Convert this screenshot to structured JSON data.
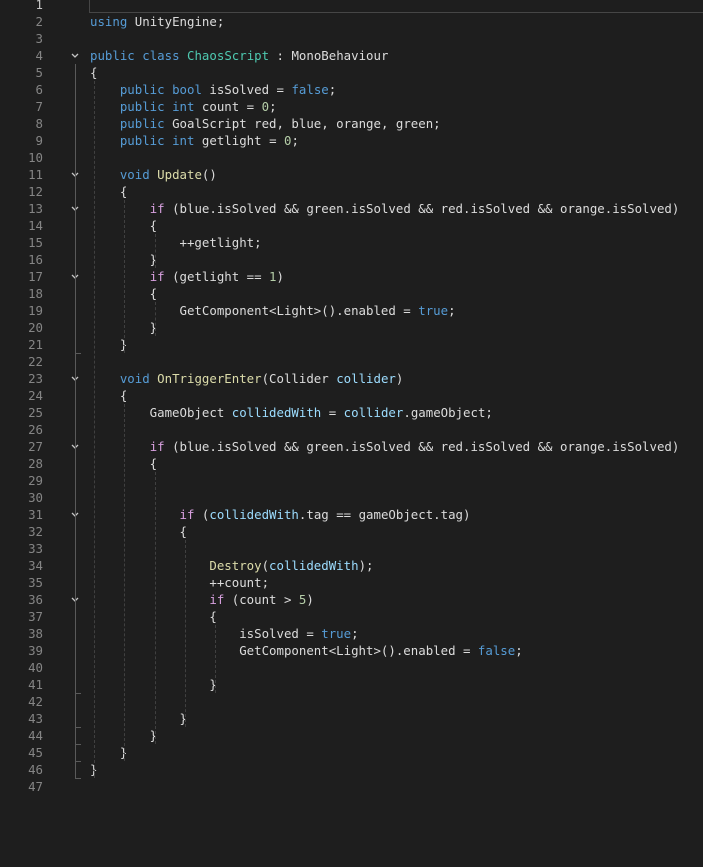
{
  "editor": {
    "language": "csharp",
    "active_line": 1,
    "colors": {
      "background": "#1e1e1e",
      "line_number": "#858585",
      "keyword": "#569cd6",
      "control": "#d8a0df",
      "type": "#4ec9b0",
      "function": "#dcdcaa",
      "number": "#b5cea8",
      "parameter": "#9cdcfe",
      "plain": "#dcdcdc"
    },
    "line_numbers": [
      "1",
      "2",
      "3",
      "4",
      "5",
      "6",
      "7",
      "8",
      "9",
      "10",
      "11",
      "12",
      "13",
      "14",
      "15",
      "16",
      "17",
      "18",
      "19",
      "20",
      "21",
      "22",
      "23",
      "24",
      "25",
      "26",
      "27",
      "28",
      "29",
      "30",
      "31",
      "32",
      "33",
      "34",
      "35",
      "36",
      "37",
      "38",
      "39",
      "40",
      "41",
      "42",
      "43",
      "44",
      "45",
      "46",
      "47"
    ],
    "folding_lines": [
      4,
      11,
      13,
      17,
      23,
      27,
      31,
      36
    ],
    "fold_icon": "chevron-down-icon",
    "lines": [
      [],
      [
        [
          "kw",
          "using"
        ],
        [
          "pl",
          " UnityEngine;"
        ]
      ],
      [],
      [
        [
          "kw",
          "public"
        ],
        [
          "pl",
          " "
        ],
        [
          "kw",
          "class"
        ],
        [
          "pl",
          " "
        ],
        [
          "ty",
          "ChaosScript"
        ],
        [
          "pl",
          " : MonoBehaviour"
        ]
      ],
      [
        [
          "pl",
          "{"
        ]
      ],
      [
        [
          "pl",
          "    "
        ],
        [
          "kw",
          "public"
        ],
        [
          "pl",
          " "
        ],
        [
          "kw",
          "bool"
        ],
        [
          "pl",
          " isSolved = "
        ],
        [
          "kw",
          "false"
        ],
        [
          "pl",
          ";"
        ]
      ],
      [
        [
          "pl",
          "    "
        ],
        [
          "kw",
          "public"
        ],
        [
          "pl",
          " "
        ],
        [
          "kw",
          "int"
        ],
        [
          "pl",
          " count = "
        ],
        [
          "num",
          "0"
        ],
        [
          "pl",
          ";"
        ]
      ],
      [
        [
          "pl",
          "    "
        ],
        [
          "kw",
          "public"
        ],
        [
          "pl",
          " GoalScript red, blue, orange, green;"
        ]
      ],
      [
        [
          "pl",
          "    "
        ],
        [
          "kw",
          "public"
        ],
        [
          "pl",
          " "
        ],
        [
          "kw",
          "int"
        ],
        [
          "pl",
          " getlight = "
        ],
        [
          "num",
          "0"
        ],
        [
          "pl",
          ";"
        ]
      ],
      [],
      [
        [
          "pl",
          "    "
        ],
        [
          "kw",
          "void"
        ],
        [
          "pl",
          " "
        ],
        [
          "fn",
          "Update"
        ],
        [
          "pl",
          "()"
        ]
      ],
      [
        [
          "pl",
          "    {"
        ]
      ],
      [
        [
          "pl",
          "        "
        ],
        [
          "ctl",
          "if"
        ],
        [
          "pl",
          " (blue.isSolved && green.isSolved && red.isSolved && orange.isSolved)"
        ]
      ],
      [
        [
          "pl",
          "        {"
        ]
      ],
      [
        [
          "pl",
          "            ++getlight;"
        ]
      ],
      [
        [
          "pl",
          "        }"
        ]
      ],
      [
        [
          "pl",
          "        "
        ],
        [
          "ctl",
          "if"
        ],
        [
          "pl",
          " (getlight == "
        ],
        [
          "num",
          "1"
        ],
        [
          "pl",
          ")"
        ]
      ],
      [
        [
          "pl",
          "        {"
        ]
      ],
      [
        [
          "pl",
          "            GetComponent<Light>().enabled = "
        ],
        [
          "kw",
          "true"
        ],
        [
          "pl",
          ";"
        ]
      ],
      [
        [
          "pl",
          "        }"
        ]
      ],
      [
        [
          "pl",
          "    }"
        ]
      ],
      [],
      [
        [
          "pl",
          "    "
        ],
        [
          "kw",
          "void"
        ],
        [
          "pl",
          " "
        ],
        [
          "fn",
          "OnTriggerEnter"
        ],
        [
          "pl",
          "(Collider "
        ],
        [
          "pm",
          "collider"
        ],
        [
          "pl",
          ")"
        ]
      ],
      [
        [
          "pl",
          "    {"
        ]
      ],
      [
        [
          "pl",
          "        GameObject "
        ],
        [
          "pm",
          "collidedWith"
        ],
        [
          "pl",
          " = "
        ],
        [
          "pm",
          "collider"
        ],
        [
          "pl",
          ".gameObject;"
        ]
      ],
      [],
      [
        [
          "pl",
          "        "
        ],
        [
          "ctl",
          "if"
        ],
        [
          "pl",
          " (blue.isSolved && green.isSolved && red.isSolved && orange.isSolved)"
        ]
      ],
      [
        [
          "pl",
          "        {"
        ]
      ],
      [],
      [],
      [
        [
          "pl",
          "            "
        ],
        [
          "ctl",
          "if"
        ],
        [
          "pl",
          " ("
        ],
        [
          "pm",
          "collidedWith"
        ],
        [
          "pl",
          ".tag == gameObject.tag)"
        ]
      ],
      [
        [
          "pl",
          "            {"
        ]
      ],
      [],
      [
        [
          "pl",
          "                "
        ],
        [
          "fn",
          "Destroy"
        ],
        [
          "pl",
          "("
        ],
        [
          "pm",
          "collidedWith"
        ],
        [
          "pl",
          ");"
        ]
      ],
      [
        [
          "pl",
          "                ++count;"
        ]
      ],
      [
        [
          "pl",
          "                "
        ],
        [
          "ctl",
          "if"
        ],
        [
          "pl",
          " (count > "
        ],
        [
          "num",
          "5"
        ],
        [
          "pl",
          ")"
        ]
      ],
      [
        [
          "pl",
          "                {"
        ]
      ],
      [
        [
          "pl",
          "                    isSolved = "
        ],
        [
          "kw",
          "true"
        ],
        [
          "pl",
          ";"
        ]
      ],
      [
        [
          "pl",
          "                    GetComponent<Light>().enabled = "
        ],
        [
          "kw",
          "false"
        ],
        [
          "pl",
          ";"
        ]
      ],
      [],
      [
        [
          "pl",
          "                }"
        ]
      ],
      [],
      [
        [
          "pl",
          "            }"
        ]
      ],
      [
        [
          "pl",
          "        }"
        ]
      ],
      [
        [
          "pl",
          "    }"
        ]
      ],
      [
        [
          "pl",
          "}"
        ]
      ],
      []
    ]
  }
}
